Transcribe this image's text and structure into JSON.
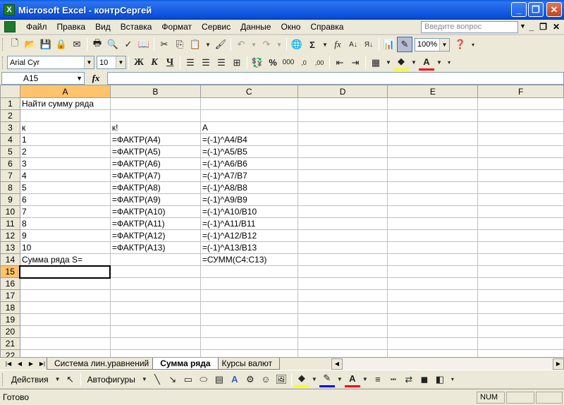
{
  "window": {
    "title": "Microsoft Excel - контрСергей"
  },
  "menu": {
    "items": [
      "Файл",
      "Правка",
      "Вид",
      "Вставка",
      "Формат",
      "Сервис",
      "Данные",
      "Окно",
      "Справка"
    ],
    "ask_placeholder": "Введите вопрос"
  },
  "toolbar": {
    "zoom": "100%",
    "font_name": "Arial Cyr",
    "font_size": "10"
  },
  "formula_bar": {
    "name_box": "A15",
    "fx": "fx",
    "formula": ""
  },
  "grid": {
    "columns": [
      "A",
      "B",
      "C",
      "D",
      "E",
      "F"
    ],
    "selected_column": "A",
    "selected_row": 15,
    "rows": [
      {
        "n": "1",
        "cells": [
          "Найти сумму ряда",
          "",
          "",
          "",
          "",
          ""
        ]
      },
      {
        "n": "2",
        "cells": [
          "",
          "",
          "",
          "",
          "",
          ""
        ]
      },
      {
        "n": "3",
        "cells": [
          "к",
          "к!",
          "А",
          "",
          "",
          ""
        ]
      },
      {
        "n": "4",
        "cells": [
          "1",
          "=ФАКТР(A4)",
          "=(-1)^A4/B4",
          "",
          "",
          ""
        ]
      },
      {
        "n": "5",
        "cells": [
          "2",
          "=ФАКТР(A5)",
          "=(-1)^A5/B5",
          "",
          "",
          ""
        ]
      },
      {
        "n": "6",
        "cells": [
          "3",
          "=ФАКТР(A6)",
          "=(-1)^A6/B6",
          "",
          "",
          ""
        ]
      },
      {
        "n": "7",
        "cells": [
          "4",
          "=ФАКТР(A7)",
          "=(-1)^A7/B7",
          "",
          "",
          ""
        ]
      },
      {
        "n": "8",
        "cells": [
          "5",
          "=ФАКТР(A8)",
          "=(-1)^A8/B8",
          "",
          "",
          ""
        ]
      },
      {
        "n": "9",
        "cells": [
          "6",
          "=ФАКТР(A9)",
          "=(-1)^A9/B9",
          "",
          "",
          ""
        ]
      },
      {
        "n": "10",
        "cells": [
          "7",
          "=ФАКТР(A10)",
          "=(-1)^A10/B10",
          "",
          "",
          ""
        ]
      },
      {
        "n": "11",
        "cells": [
          "8",
          "=ФАКТР(A11)",
          "=(-1)^A11/B11",
          "",
          "",
          ""
        ]
      },
      {
        "n": "12",
        "cells": [
          "9",
          "=ФАКТР(A12)",
          "=(-1)^A12/B12",
          "",
          "",
          ""
        ]
      },
      {
        "n": "13",
        "cells": [
          "10",
          "=ФАКТР(A13)",
          "=(-1)^A13/B13",
          "",
          "",
          ""
        ]
      },
      {
        "n": "14",
        "cells": [
          "Сумма ряда S=",
          "",
          "=СУММ(C4:C13)",
          "",
          "",
          ""
        ]
      },
      {
        "n": "15",
        "cells": [
          "",
          "",
          "",
          "",
          "",
          ""
        ]
      },
      {
        "n": "16",
        "cells": [
          "",
          "",
          "",
          "",
          "",
          ""
        ]
      },
      {
        "n": "17",
        "cells": [
          "",
          "",
          "",
          "",
          "",
          ""
        ]
      },
      {
        "n": "18",
        "cells": [
          "",
          "",
          "",
          "",
          "",
          ""
        ]
      },
      {
        "n": "19",
        "cells": [
          "",
          "",
          "",
          "",
          "",
          ""
        ]
      },
      {
        "n": "20",
        "cells": [
          "",
          "",
          "",
          "",
          "",
          ""
        ]
      },
      {
        "n": "21",
        "cells": [
          "",
          "",
          "",
          "",
          "",
          ""
        ]
      },
      {
        "n": "22",
        "cells": [
          "",
          "",
          "",
          "",
          "",
          ""
        ]
      }
    ]
  },
  "sheet_tabs": [
    {
      "label": "Система лин.уравнений",
      "active": false
    },
    {
      "label": "Сумма ряда",
      "active": true
    },
    {
      "label": "Курсы валют",
      "active": false
    }
  ],
  "draw_toolbar": {
    "actions_label": "Действия",
    "autoshapes_label": "Автофигуры"
  },
  "status": {
    "text": "Готово",
    "num": "NUM"
  }
}
